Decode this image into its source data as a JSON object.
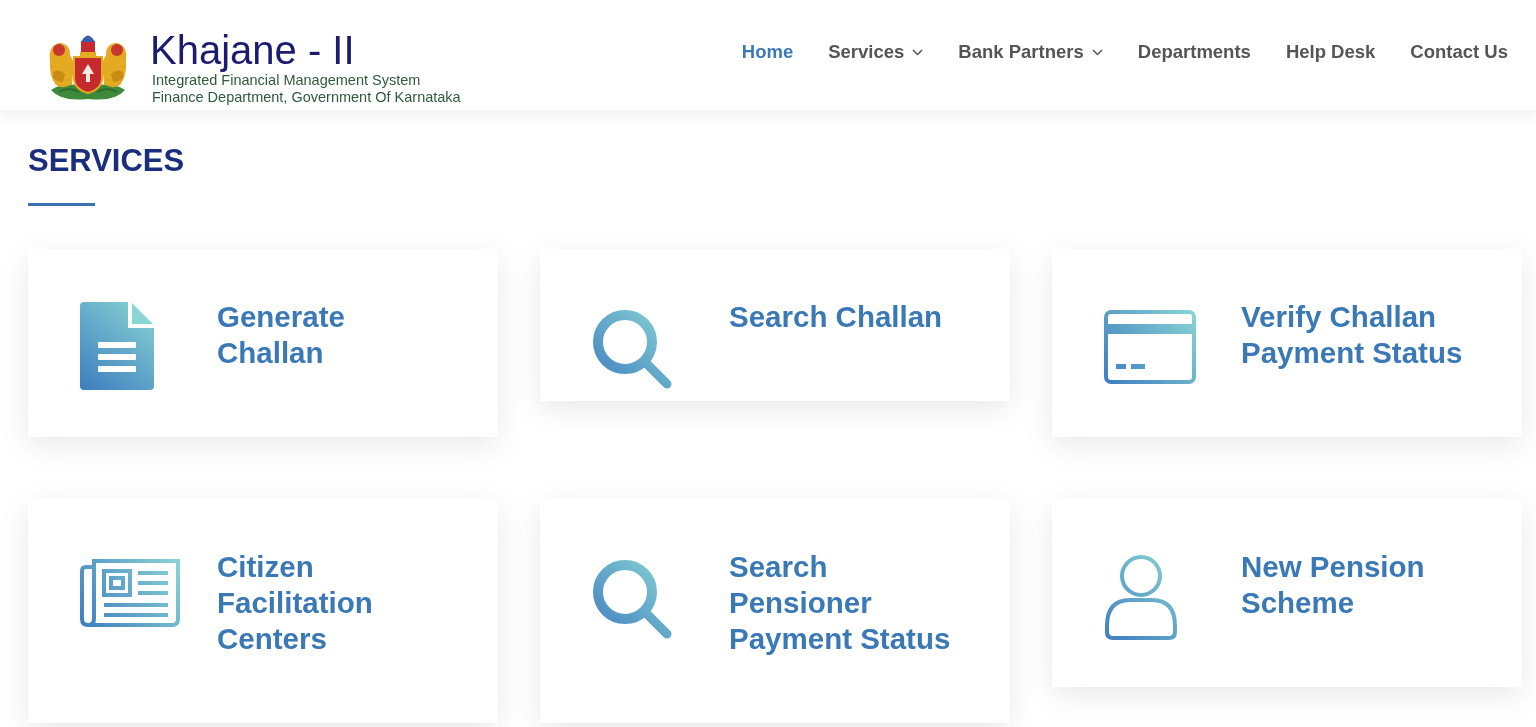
{
  "header": {
    "logo": {
      "title": "Khajane - II",
      "subtitle": "Integrated Financial Management System",
      "department": "Finance Department, Government Of Karnataka"
    },
    "nav": [
      {
        "label": "Home",
        "selected": true,
        "dropdown": false
      },
      {
        "label": "Services",
        "selected": false,
        "dropdown": true
      },
      {
        "label": "Bank Partners",
        "selected": false,
        "dropdown": true
      },
      {
        "label": "Departments",
        "selected": false,
        "dropdown": false
      },
      {
        "label": "Help Desk",
        "selected": false,
        "dropdown": false
      },
      {
        "label": "Contact Us",
        "selected": false,
        "dropdown": false
      }
    ]
  },
  "section": {
    "title": "SERVICES"
  },
  "services": [
    {
      "title": "Generate Challan",
      "kind": "document"
    },
    {
      "title": "Search Challan",
      "kind": "search"
    },
    {
      "title": "Verify Challan Payment Status",
      "kind": "card"
    },
    {
      "title": "Citizen Facilitation Centers",
      "kind": "newspaper"
    },
    {
      "title": "Search Pensioner Payment Status",
      "kind": "search"
    },
    {
      "title": "New Pension Scheme",
      "kind": "person"
    }
  ]
}
